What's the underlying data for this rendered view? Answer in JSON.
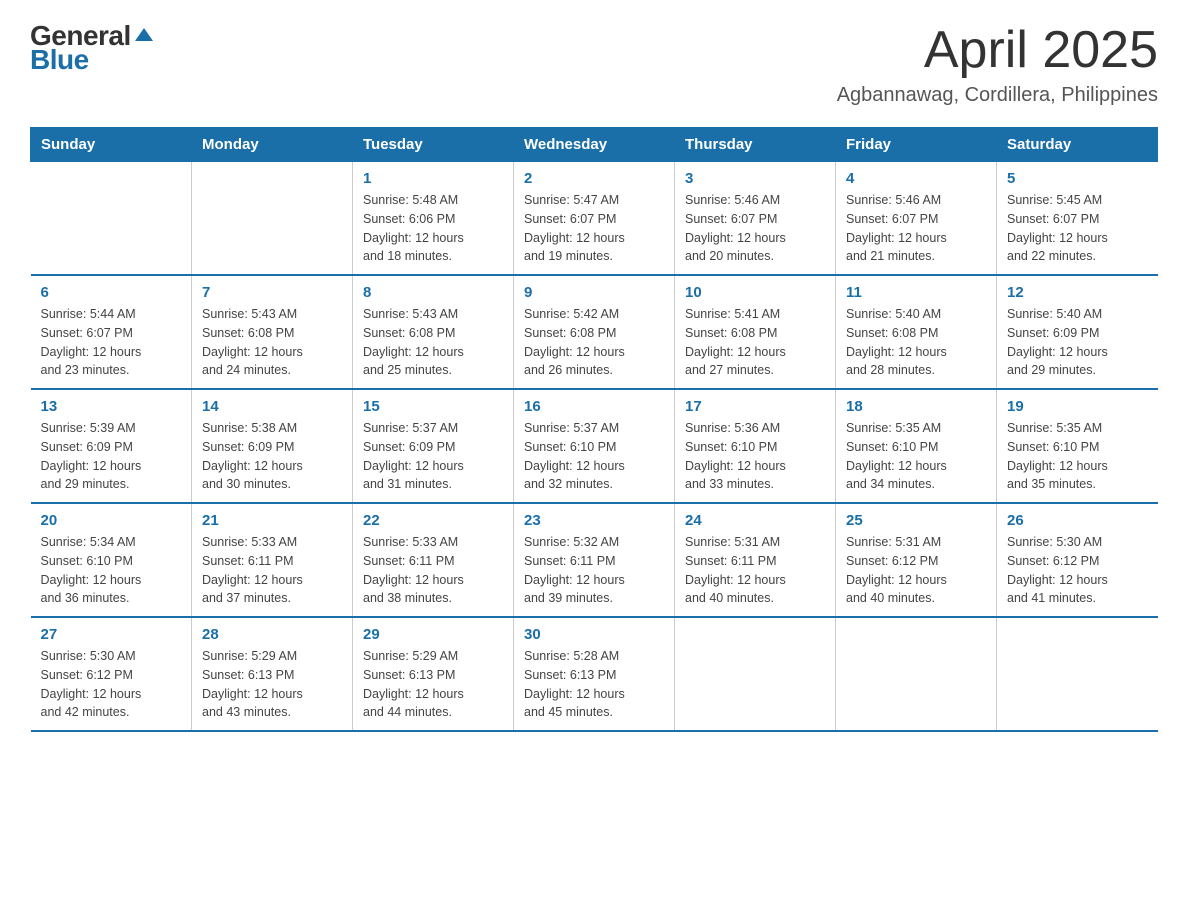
{
  "logo": {
    "general": "General",
    "blue": "Blue"
  },
  "title": "April 2025",
  "subtitle": "Agbannawag, Cordillera, Philippines",
  "weekdays": [
    "Sunday",
    "Monday",
    "Tuesday",
    "Wednesday",
    "Thursday",
    "Friday",
    "Saturday"
  ],
  "weeks": [
    [
      {
        "day": "",
        "info": ""
      },
      {
        "day": "",
        "info": ""
      },
      {
        "day": "1",
        "info": "Sunrise: 5:48 AM\nSunset: 6:06 PM\nDaylight: 12 hours\nand 18 minutes."
      },
      {
        "day": "2",
        "info": "Sunrise: 5:47 AM\nSunset: 6:07 PM\nDaylight: 12 hours\nand 19 minutes."
      },
      {
        "day": "3",
        "info": "Sunrise: 5:46 AM\nSunset: 6:07 PM\nDaylight: 12 hours\nand 20 minutes."
      },
      {
        "day": "4",
        "info": "Sunrise: 5:46 AM\nSunset: 6:07 PM\nDaylight: 12 hours\nand 21 minutes."
      },
      {
        "day": "5",
        "info": "Sunrise: 5:45 AM\nSunset: 6:07 PM\nDaylight: 12 hours\nand 22 minutes."
      }
    ],
    [
      {
        "day": "6",
        "info": "Sunrise: 5:44 AM\nSunset: 6:07 PM\nDaylight: 12 hours\nand 23 minutes."
      },
      {
        "day": "7",
        "info": "Sunrise: 5:43 AM\nSunset: 6:08 PM\nDaylight: 12 hours\nand 24 minutes."
      },
      {
        "day": "8",
        "info": "Sunrise: 5:43 AM\nSunset: 6:08 PM\nDaylight: 12 hours\nand 25 minutes."
      },
      {
        "day": "9",
        "info": "Sunrise: 5:42 AM\nSunset: 6:08 PM\nDaylight: 12 hours\nand 26 minutes."
      },
      {
        "day": "10",
        "info": "Sunrise: 5:41 AM\nSunset: 6:08 PM\nDaylight: 12 hours\nand 27 minutes."
      },
      {
        "day": "11",
        "info": "Sunrise: 5:40 AM\nSunset: 6:08 PM\nDaylight: 12 hours\nand 28 minutes."
      },
      {
        "day": "12",
        "info": "Sunrise: 5:40 AM\nSunset: 6:09 PM\nDaylight: 12 hours\nand 29 minutes."
      }
    ],
    [
      {
        "day": "13",
        "info": "Sunrise: 5:39 AM\nSunset: 6:09 PM\nDaylight: 12 hours\nand 29 minutes."
      },
      {
        "day": "14",
        "info": "Sunrise: 5:38 AM\nSunset: 6:09 PM\nDaylight: 12 hours\nand 30 minutes."
      },
      {
        "day": "15",
        "info": "Sunrise: 5:37 AM\nSunset: 6:09 PM\nDaylight: 12 hours\nand 31 minutes."
      },
      {
        "day": "16",
        "info": "Sunrise: 5:37 AM\nSunset: 6:10 PM\nDaylight: 12 hours\nand 32 minutes."
      },
      {
        "day": "17",
        "info": "Sunrise: 5:36 AM\nSunset: 6:10 PM\nDaylight: 12 hours\nand 33 minutes."
      },
      {
        "day": "18",
        "info": "Sunrise: 5:35 AM\nSunset: 6:10 PM\nDaylight: 12 hours\nand 34 minutes."
      },
      {
        "day": "19",
        "info": "Sunrise: 5:35 AM\nSunset: 6:10 PM\nDaylight: 12 hours\nand 35 minutes."
      }
    ],
    [
      {
        "day": "20",
        "info": "Sunrise: 5:34 AM\nSunset: 6:10 PM\nDaylight: 12 hours\nand 36 minutes."
      },
      {
        "day": "21",
        "info": "Sunrise: 5:33 AM\nSunset: 6:11 PM\nDaylight: 12 hours\nand 37 minutes."
      },
      {
        "day": "22",
        "info": "Sunrise: 5:33 AM\nSunset: 6:11 PM\nDaylight: 12 hours\nand 38 minutes."
      },
      {
        "day": "23",
        "info": "Sunrise: 5:32 AM\nSunset: 6:11 PM\nDaylight: 12 hours\nand 39 minutes."
      },
      {
        "day": "24",
        "info": "Sunrise: 5:31 AM\nSunset: 6:11 PM\nDaylight: 12 hours\nand 40 minutes."
      },
      {
        "day": "25",
        "info": "Sunrise: 5:31 AM\nSunset: 6:12 PM\nDaylight: 12 hours\nand 40 minutes."
      },
      {
        "day": "26",
        "info": "Sunrise: 5:30 AM\nSunset: 6:12 PM\nDaylight: 12 hours\nand 41 minutes."
      }
    ],
    [
      {
        "day": "27",
        "info": "Sunrise: 5:30 AM\nSunset: 6:12 PM\nDaylight: 12 hours\nand 42 minutes."
      },
      {
        "day": "28",
        "info": "Sunrise: 5:29 AM\nSunset: 6:13 PM\nDaylight: 12 hours\nand 43 minutes."
      },
      {
        "day": "29",
        "info": "Sunrise: 5:29 AM\nSunset: 6:13 PM\nDaylight: 12 hours\nand 44 minutes."
      },
      {
        "day": "30",
        "info": "Sunrise: 5:28 AM\nSunset: 6:13 PM\nDaylight: 12 hours\nand 45 minutes."
      },
      {
        "day": "",
        "info": ""
      },
      {
        "day": "",
        "info": ""
      },
      {
        "day": "",
        "info": ""
      }
    ]
  ]
}
